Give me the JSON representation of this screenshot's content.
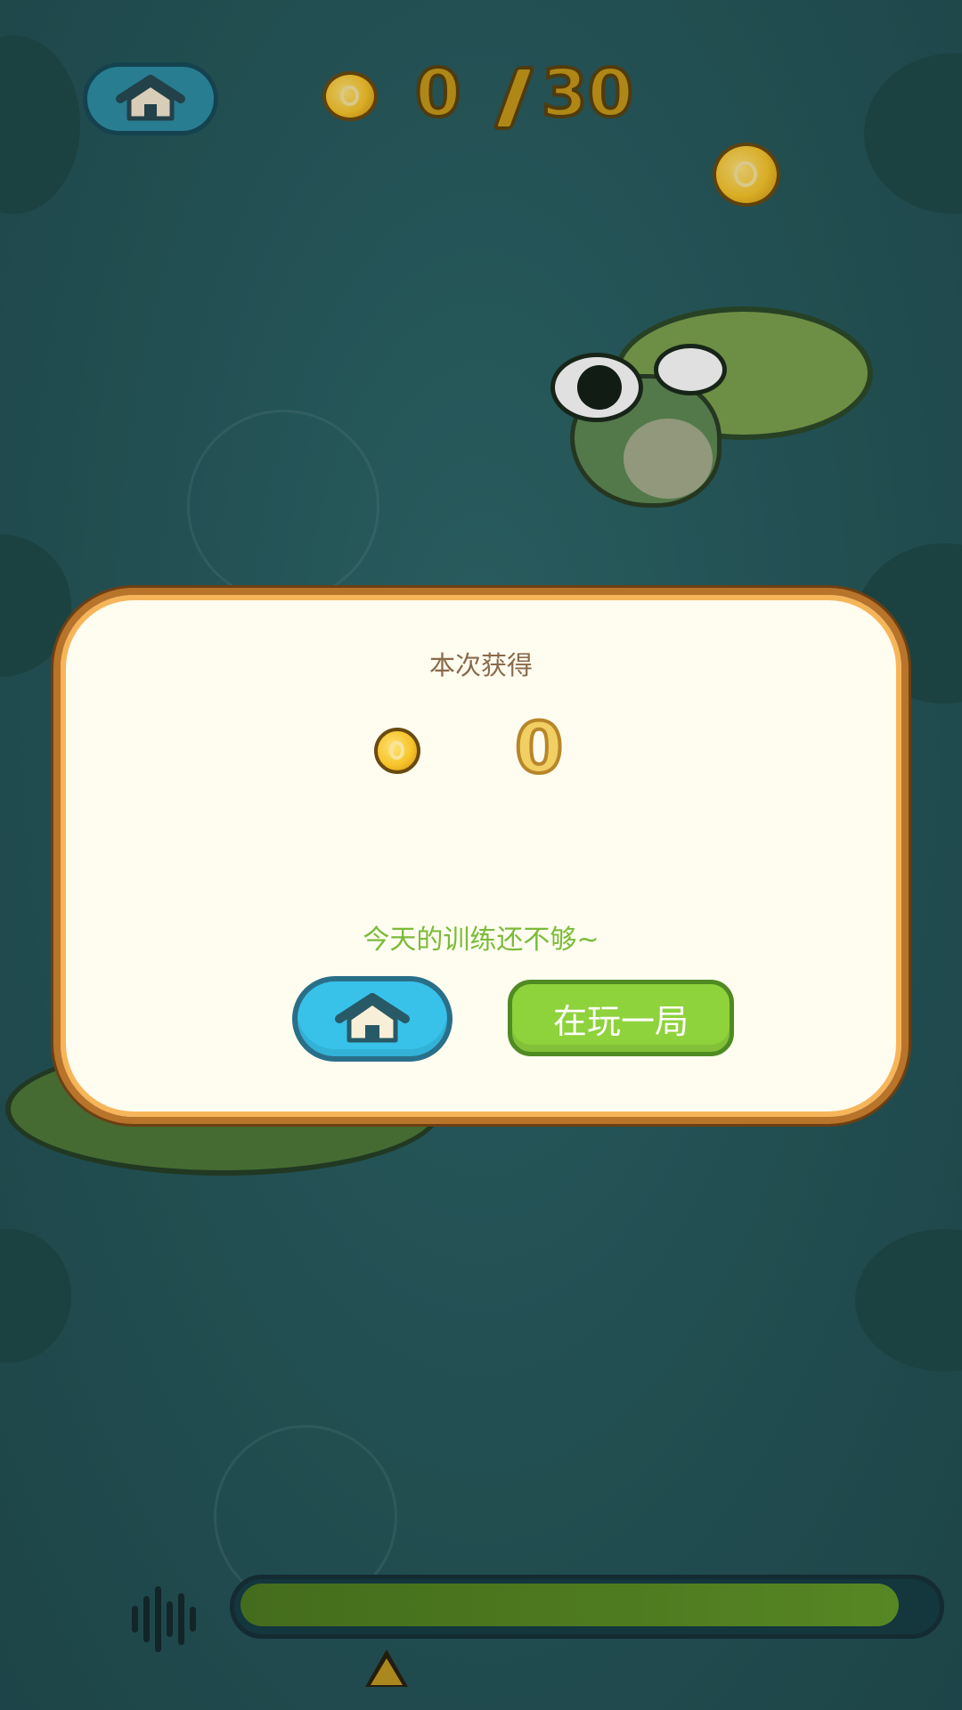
{
  "hud": {
    "home_icon": "house-icon",
    "coin_icon": "coin-icon",
    "collected": "0",
    "target": "30"
  },
  "dialog": {
    "title": "本次获得",
    "coin_icon": "coin-icon",
    "earned": "0",
    "message": "今天的训练还不够~",
    "home_icon": "house-icon",
    "replay_label": "在玩一局"
  },
  "bottom": {
    "sound_icon": "soundwave-icon",
    "progress": 0.95
  },
  "colors": {
    "water": "#285c5f",
    "dialog_bg": "#fffdf0",
    "dialog_border": "#b8742a",
    "coin": "#f7c52a",
    "home_button": "#38c2ea",
    "replay_button": "#8ed23c",
    "message_text": "#7bbb3a"
  }
}
